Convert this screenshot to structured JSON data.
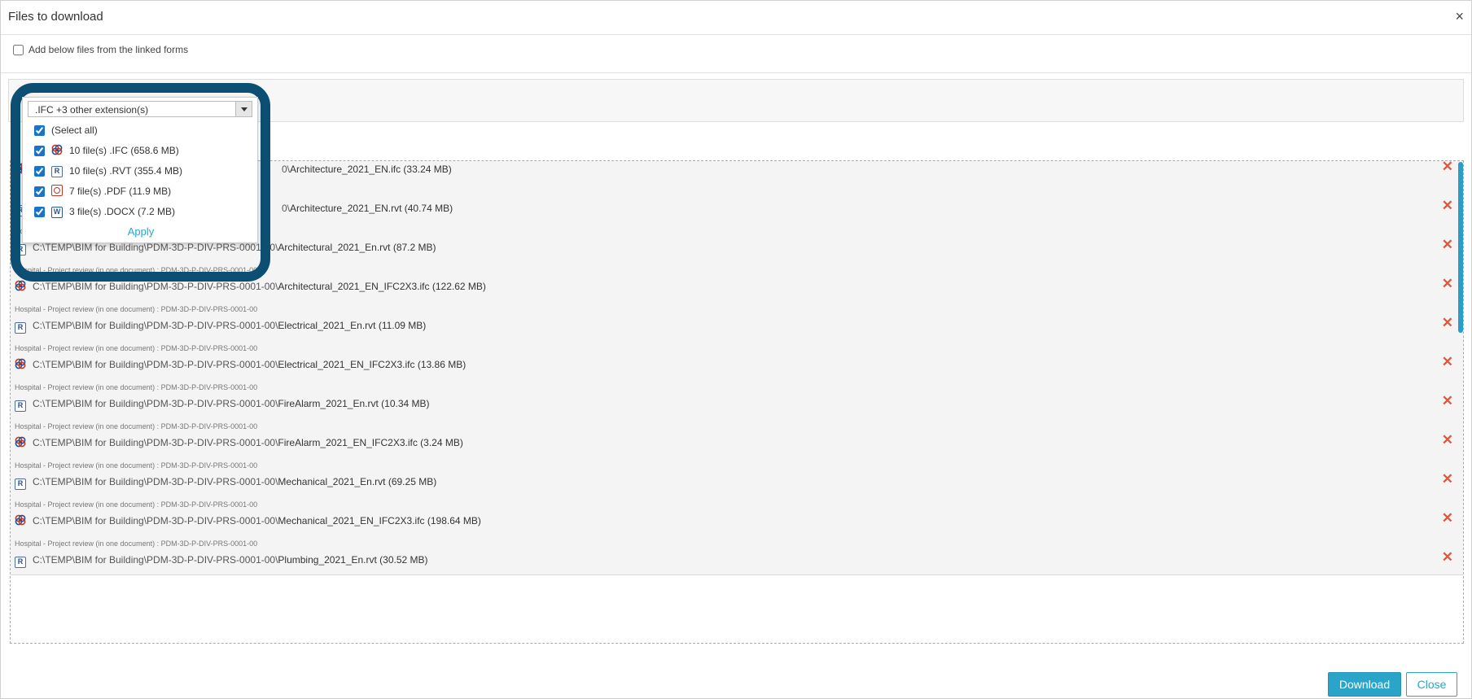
{
  "dialog": {
    "title": "Files to download",
    "close_glyph": "×"
  },
  "linked_forms": {
    "label": "Add below files from the linked forms",
    "checked": false
  },
  "filter_dropdown": {
    "selected_text": ".IFC +3 other extension(s)",
    "options": [
      {
        "label": "(Select all)",
        "checked": true,
        "icon": null
      },
      {
        "label": "10 file(s) .IFC (658.6 MB)",
        "checked": true,
        "icon": "ifc-icon"
      },
      {
        "label": "10 file(s) .RVT (355.4 MB)",
        "checked": true,
        "icon": "rvt-icon"
      },
      {
        "label": "7 file(s) .PDF (11.9 MB)",
        "checked": true,
        "icon": "pdf-icon"
      },
      {
        "label": "3 file(s) .DOCX (7.2 MB)",
        "checked": true,
        "icon": "docx-icon"
      }
    ],
    "apply_label": "Apply"
  },
  "files": [
    {
      "context": "",
      "path_prefix": "0\\",
      "filename": "Architecture_2021_EN.ifc (33.24 MB)",
      "type": "ifc"
    },
    {
      "context": "",
      "path_prefix": "0\\",
      "filename": "Architecture_2021_EN.rvt (40.74 MB)",
      "type": "rvt"
    },
    {
      "context": "Hospital - Project review (in one document) : PDM-3D-P-DIV-PRS-0001-00",
      "path_prefix": "C:\\TEMP\\BIM for Building\\PDM-3D-P-DIV-PRS-0001-00\\",
      "filename": "Architectural_2021_En.rvt (87.2 MB)",
      "type": "rvt"
    },
    {
      "context": "Hospital - Project review (in one document) : PDM-3D-P-DIV-PRS-0001-00",
      "path_prefix": "C:\\TEMP\\BIM for Building\\PDM-3D-P-DIV-PRS-0001-00\\",
      "filename": "Architectural_2021_EN_IFC2X3.ifc (122.62 MB)",
      "type": "ifc"
    },
    {
      "context": "Hospital - Project review (in one document) : PDM-3D-P-DIV-PRS-0001-00",
      "path_prefix": "C:\\TEMP\\BIM for Building\\PDM-3D-P-DIV-PRS-0001-00\\",
      "filename": "Electrical_2021_En.rvt (11.09 MB)",
      "type": "rvt"
    },
    {
      "context": "Hospital - Project review (in one document) : PDM-3D-P-DIV-PRS-0001-00",
      "path_prefix": "C:\\TEMP\\BIM for Building\\PDM-3D-P-DIV-PRS-0001-00\\",
      "filename": "Electrical_2021_EN_IFC2X3.ifc (13.86 MB)",
      "type": "ifc"
    },
    {
      "context": "Hospital - Project review (in one document) : PDM-3D-P-DIV-PRS-0001-00",
      "path_prefix": "C:\\TEMP\\BIM for Building\\PDM-3D-P-DIV-PRS-0001-00\\",
      "filename": "FireAlarm_2021_En.rvt (10.34 MB)",
      "type": "rvt"
    },
    {
      "context": "Hospital - Project review (in one document) : PDM-3D-P-DIV-PRS-0001-00",
      "path_prefix": "C:\\TEMP\\BIM for Building\\PDM-3D-P-DIV-PRS-0001-00\\",
      "filename": "FireAlarm_2021_EN_IFC2X3.ifc (3.24 MB)",
      "type": "ifc"
    },
    {
      "context": "Hospital - Project review (in one document) : PDM-3D-P-DIV-PRS-0001-00",
      "path_prefix": "C:\\TEMP\\BIM for Building\\PDM-3D-P-DIV-PRS-0001-00\\",
      "filename": "Mechanical_2021_En.rvt (69.25 MB)",
      "type": "rvt"
    },
    {
      "context": "Hospital - Project review (in one document) : PDM-3D-P-DIV-PRS-0001-00",
      "path_prefix": "C:\\TEMP\\BIM for Building\\PDM-3D-P-DIV-PRS-0001-00\\",
      "filename": "Mechanical_2021_EN_IFC2X3.ifc (198.64 MB)",
      "type": "ifc"
    },
    {
      "context": "Hospital - Project review (in one document) : PDM-3D-P-DIV-PRS-0001-00",
      "path_prefix": "C:\\TEMP\\BIM for Building\\PDM-3D-P-DIV-PRS-0001-00\\",
      "filename": "Plumbing_2021_En.rvt (30.52 MB)",
      "type": "rvt"
    }
  ],
  "remove_glyph": "✕",
  "buttons": {
    "download": "Download",
    "close": "Close"
  },
  "colors": {
    "accent": "#2aa5c9",
    "highlight_border": "#0d4f72",
    "remove": "#e0563e"
  }
}
